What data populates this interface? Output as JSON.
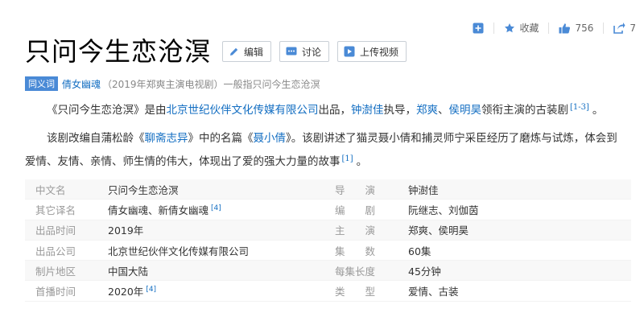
{
  "actions": {
    "collect_label": "收藏",
    "like_count": "756",
    "share_count": "7"
  },
  "title": "只问今生恋沧溟",
  "title_buttons": {
    "edit": "编辑",
    "discuss": "讨论",
    "upload_video": "上传视频"
  },
  "synonym": {
    "badge": "同义词",
    "link": "倩女幽魂",
    "desc": "（2019年郑爽主演电视剧）一般指只问今生恋沧溟"
  },
  "para1": {
    "t1": "《只问今生恋沧溟》是由",
    "company": "北京世纪伙伴文化传媒有限公司",
    "t2": "出品，",
    "director": "钟澍佳",
    "t3": "执导，",
    "actor1": "郑爽",
    "t4": "、",
    "actor2": "侯明昊",
    "t5": "领衔主演的古装剧",
    "ref": "[1-3]",
    "t6": "。"
  },
  "para2": {
    "t1": "该剧改编自蒲松龄《",
    "book": "聊斋志异",
    "t2": "》中的名篇《",
    "story": "聂小倩",
    "t3": "》。该剧讲述了猫灵聂小倩和捕灵师宁采臣经历了磨炼与试炼，体会到爱情、友情、亲情、师生情的伟大，体现出了爱的强大力量的故事",
    "ref": "[1]",
    "t4": "。"
  },
  "info": [
    {
      "k1": "中文名",
      "v1": "只问今生恋沧溟",
      "r1": "",
      "k2": "导　　演",
      "v2": "钟澍佳"
    },
    {
      "k1": "其它译名",
      "v1": "倩女幽魂、新倩女幽魂",
      "r1": "[4]",
      "k2": "编　　剧",
      "v2": "阮继志、刘伽茵"
    },
    {
      "k1": "出品时间",
      "v1": "2019年",
      "r1": "",
      "k2": "主　　演",
      "v2": "郑爽、侯明昊"
    },
    {
      "k1": "出品公司",
      "v1": "北京世纪伙伴文化传媒有限公司",
      "r1": "",
      "k2": "集　　数",
      "v2": "60集"
    },
    {
      "k1": "制片地区",
      "v1": "中国大陆",
      "r1": "",
      "k2": "每集长度",
      "v2": "45分钟"
    },
    {
      "k1": "首播时间",
      "v1": "2020年",
      "r1": "[4]",
      "k2": "类　　型",
      "v2": "爱情、古装"
    }
  ],
  "colors": {
    "link": "#136ec2",
    "badge": "#4a8ad6",
    "icon": "#4a8ad6"
  }
}
